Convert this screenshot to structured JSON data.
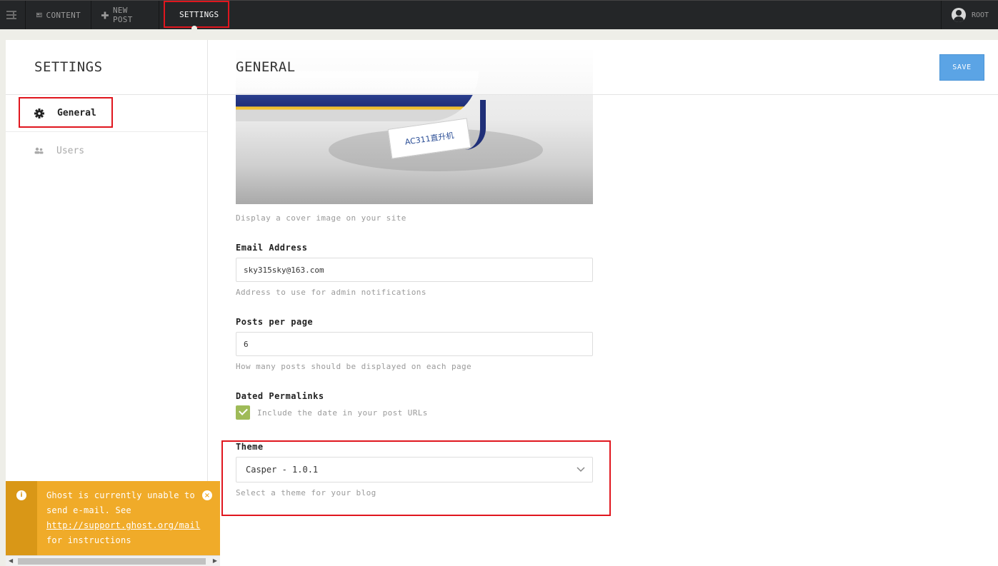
{
  "topbar": {
    "menu_icon": "menu-toggle-icon",
    "content_label": "CONTENT",
    "newpost_label": "NEW POST",
    "settings_label": "SETTINGS",
    "user_label": "ROOT"
  },
  "sidebar": {
    "title": "SETTINGS",
    "items": [
      {
        "label": "General",
        "icon": "gear-icon"
      },
      {
        "label": "Users",
        "icon": "users-icon"
      }
    ]
  },
  "main": {
    "title": "GENERAL",
    "save_label": "SAVE",
    "cover": {
      "sign_text": "AC311直升机",
      "help": "Display a cover image on your site"
    },
    "email": {
      "label": "Email Address",
      "value": "sky315sky@163.com",
      "help": "Address to use for admin notifications"
    },
    "posts_per_page": {
      "label": "Posts per page",
      "value": "6",
      "help": "How many posts should be displayed on each page"
    },
    "dated_permalinks": {
      "label": "Dated Permalinks",
      "checked": true,
      "help": "Include the date in your post URLs"
    },
    "theme": {
      "label": "Theme",
      "value": "Casper - 1.0.1",
      "help": "Select a theme for your blog"
    }
  },
  "notification": {
    "text1": "Ghost is currently unable to send e-mail. See",
    "link": "http://support.ghost.org/mail",
    "text2": "for instructions"
  },
  "colors": {
    "topbar_bg": "#242628",
    "accent_red": "#e0161e",
    "save_blue": "#5ba4e5",
    "check_green": "#9fbb58",
    "notify_orange": "#f0ab29"
  }
}
